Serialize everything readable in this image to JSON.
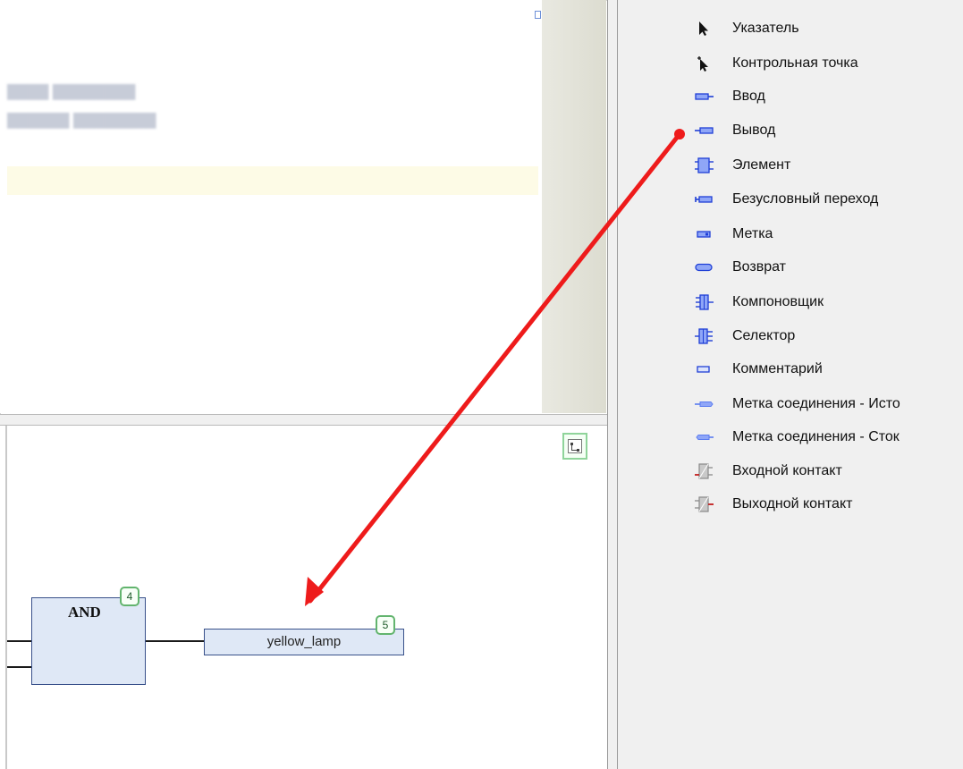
{
  "diagram": {
    "and_block": {
      "label": "AND",
      "badge": "4"
    },
    "output_block": {
      "label": "yellow_lamp",
      "badge": "5"
    }
  },
  "toolbox": {
    "items": [
      {
        "label": "Указатель",
        "icon": "pointer-icon"
      },
      {
        "label": "Контрольная точка",
        "icon": "checkpoint-icon"
      },
      {
        "label": "Ввод",
        "icon": "input-icon"
      },
      {
        "label": "Вывод",
        "icon": "output-icon"
      },
      {
        "label": "Элемент",
        "icon": "box-icon"
      },
      {
        "label": "Безусловный переход",
        "icon": "jump-icon"
      },
      {
        "label": "Метка",
        "icon": "label-icon"
      },
      {
        "label": "Возврат",
        "icon": "return-icon"
      },
      {
        "label": "Компоновщик",
        "icon": "composer-icon"
      },
      {
        "label": "Селектор",
        "icon": "selector-icon"
      },
      {
        "label": "Комментарий",
        "icon": "comment-icon"
      },
      {
        "label": "Метка соединения - Исто",
        "icon": "connection-mark-source-icon"
      },
      {
        "label": "Метка соединения - Сток",
        "icon": "connection-mark-sink-icon"
      },
      {
        "label": "Входной контакт",
        "icon": "input-pin-icon"
      },
      {
        "label": "Выходной контакт",
        "icon": "output-pin-icon"
      }
    ]
  },
  "colors": {
    "block_fill": "#dfe8f6",
    "block_border": "#38508a",
    "badge_border": "#62b46e",
    "annotation_arrow": "#ee1b1b",
    "toolbox_bg": "#f0f0f0"
  }
}
